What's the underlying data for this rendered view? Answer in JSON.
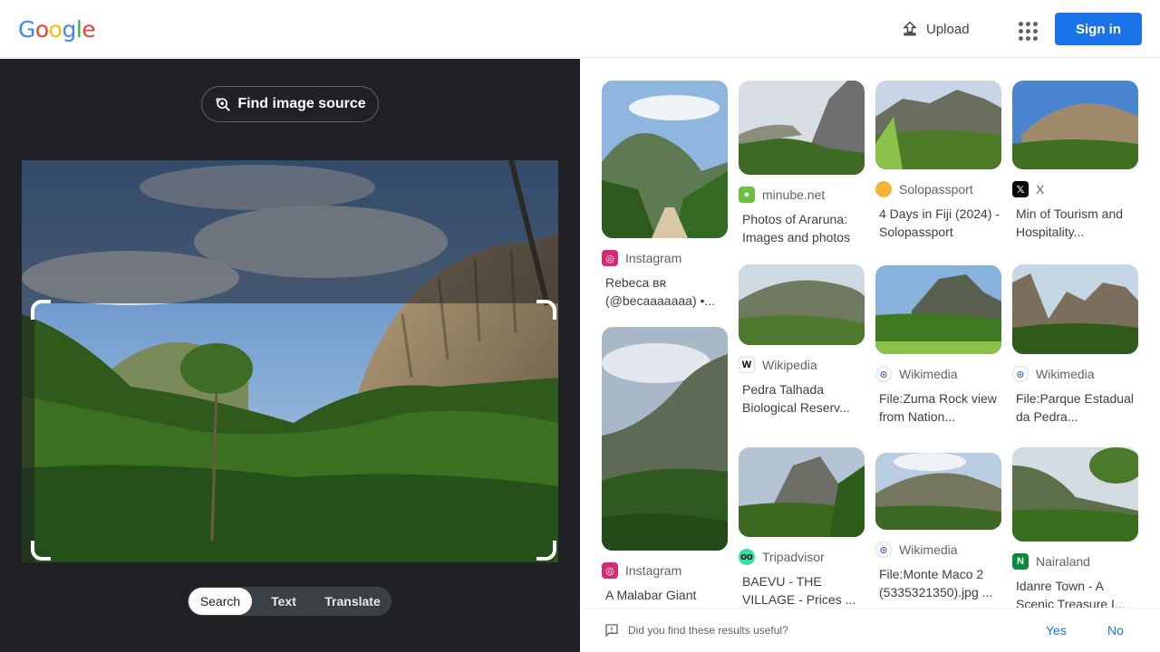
{
  "header": {
    "logo_letters": [
      "G",
      "o",
      "o",
      "g",
      "l",
      "e"
    ],
    "logo_colors": [
      "#4285F4",
      "#EA4335",
      "#FBBC05",
      "#4285F4",
      "#34A853",
      "#EA4335"
    ],
    "upload_label": "Upload",
    "apps_icon": "apps-grid-icon",
    "signin_label": "Sign in"
  },
  "left": {
    "find_source_label": "Find image source",
    "modes": [
      "Search",
      "Text",
      "Translate"
    ],
    "active_mode": "Search"
  },
  "results": [
    {
      "source": "Instagram",
      "title": "Rebeca ʙʀ (@becaaaaaaa) •...",
      "favicon": "instagram-icon",
      "color": "#d62976"
    },
    {
      "source": "minube.net",
      "title": "Photos of Araruna: Images and photos",
      "favicon": "minube-icon",
      "color": "#6bc13a"
    },
    {
      "source": "Solopassport",
      "title": "4 Days in Fiji (2024) - Solopassport",
      "favicon": "solopassport-icon",
      "color": "#f2b632"
    },
    {
      "source": "X",
      "title": "Min of Tourism and Hospitality...",
      "favicon": "x-icon",
      "color": "#000000"
    },
    {
      "source": "Wikipedia",
      "title": "Pedra Talhada Biological Reserv...",
      "favicon": "wikipedia-icon",
      "color": "#ffffff"
    },
    {
      "source": "Wikimedia",
      "title": "File:Zuma Rock view from Nation...",
      "favicon": "wikimedia-icon",
      "color": "#ffffff"
    },
    {
      "source": "Wikimedia",
      "title": "File:Parque Estadual da Pedra...",
      "favicon": "wikimedia-icon",
      "color": "#ffffff"
    },
    {
      "source": "Instagram",
      "title": "A Malabar Giant",
      "favicon": "instagram-icon",
      "color": "#d62976"
    },
    {
      "source": "Tripadvisor",
      "title": "BAEVU - THE VILLAGE - Prices ...",
      "favicon": "tripadvisor-icon",
      "color": "#34e0a1"
    },
    {
      "source": "Wikimedia",
      "title": "File:Monte Maco 2 (5335321350).jpg ...",
      "favicon": "wikimedia-icon",
      "color": "#ffffff"
    },
    {
      "source": "Nairaland",
      "title": "Idanre Town - A Scenic Treasure I...",
      "favicon": "nairaland-icon",
      "color": "#0a8a3a"
    }
  ],
  "feedback": {
    "question": "Did you find these results useful?",
    "yes": "Yes",
    "no": "No"
  }
}
